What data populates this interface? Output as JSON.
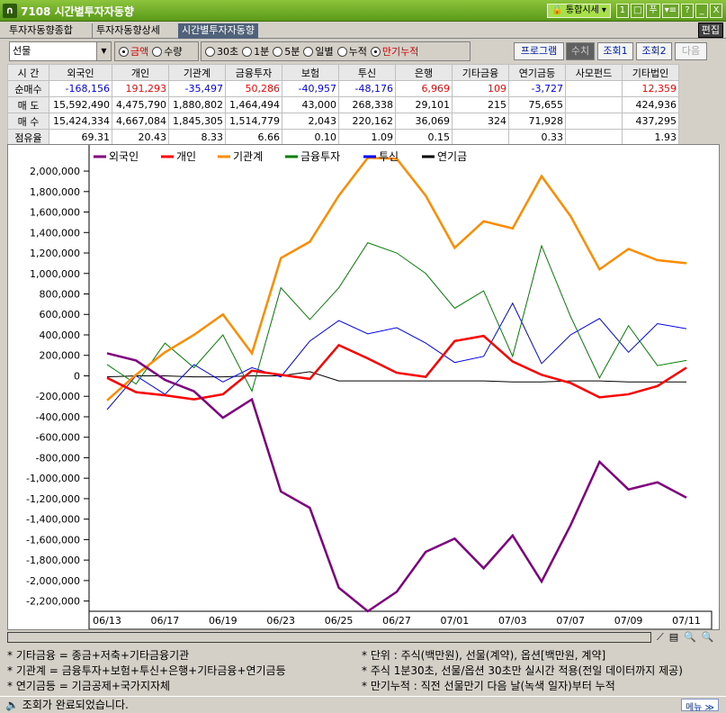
{
  "window": {
    "code": "7108",
    "title": "시간별투자자동향",
    "main_menu": "통합시세",
    "buttons": [
      "1",
      "□",
      "푸",
      "▾≡",
      "?",
      "_",
      "X"
    ]
  },
  "tabs": [
    {
      "label": "투자자동향종합"
    },
    {
      "label": "투자자동향상세"
    },
    {
      "label": "시간별투자자동향"
    }
  ],
  "edit_label": "편집",
  "controls": {
    "market": "선물",
    "unit": [
      {
        "label": "금액",
        "checked": true
      },
      {
        "label": "수량",
        "checked": false
      }
    ],
    "period": [
      {
        "label": "30초",
        "checked": false
      },
      {
        "label": "1분",
        "checked": false
      },
      {
        "label": "5분",
        "checked": false
      },
      {
        "label": "일별",
        "checked": false
      },
      {
        "label": "누적",
        "checked": false
      },
      {
        "label": "만기누적",
        "checked": true
      }
    ],
    "buttons": [
      "프로그램",
      "수치",
      "조회1",
      "조회2",
      "다음"
    ]
  },
  "table": {
    "headers": [
      "시  간",
      "외국인",
      "개인",
      "기관계",
      "금융투자",
      "보험",
      "투신",
      "은행",
      "기타금융",
      "연기금등",
      "사모펀드",
      "기타법인"
    ],
    "rows": [
      {
        "label": "순매수",
        "cells": [
          "-168,156",
          "191,293",
          "-35,497",
          "50,286",
          "-40,957",
          "-48,176",
          "6,969",
          "109",
          "-3,727",
          "",
          "12,359"
        ]
      },
      {
        "label": "매  도",
        "cells": [
          "15,592,490",
          "4,475,790",
          "1,880,802",
          "1,464,494",
          "43,000",
          "268,338",
          "29,101",
          "215",
          "75,655",
          "",
          "424,936"
        ]
      },
      {
        "label": "매  수",
        "cells": [
          "15,424,334",
          "4,667,084",
          "1,845,305",
          "1,514,779",
          "2,043",
          "220,162",
          "36,069",
          "324",
          "71,928",
          "",
          "437,295"
        ]
      },
      {
        "label": "점유율",
        "cells": [
          "69.31",
          "20.43",
          "8.33",
          "6.66",
          "0.10",
          "1.09",
          "0.15",
          "",
          "0.33",
          "",
          "1.93"
        ]
      }
    ]
  },
  "chart_data": {
    "type": "line",
    "ylim": [
      -2300000,
      2150000
    ],
    "yticks": [
      2000000,
      1800000,
      1600000,
      1400000,
      1200000,
      1000000,
      800000,
      600000,
      400000,
      200000,
      0,
      -200000,
      -400000,
      -600000,
      -800000,
      -1000000,
      -1200000,
      -1400000,
      -1600000,
      -1800000,
      -2000000,
      -2200000
    ],
    "ytick_labels": [
      "2,000,000",
      "1,800,000",
      "1,600,000",
      "1,400,000",
      "1,200,000",
      "1,000,000",
      "800,000",
      "600,000",
      "400,000",
      "200,000",
      "0",
      "-200,000",
      "-400,000",
      "-600,000",
      "-800,000",
      "-1,000,000",
      "-1,200,000",
      "-1,400,000",
      "-1,600,000",
      "-1,800,000",
      "-2,000,000",
      "-2,200,000"
    ],
    "x_count": 21,
    "xtick_labels": [
      {
        "i": 0,
        "label": "06/13"
      },
      {
        "i": 2,
        "label": "06/17"
      },
      {
        "i": 4,
        "label": "06/19"
      },
      {
        "i": 6,
        "label": "06/23"
      },
      {
        "i": 8,
        "label": "06/25"
      },
      {
        "i": 10,
        "label": "06/27"
      },
      {
        "i": 12,
        "label": "07/01"
      },
      {
        "i": 14,
        "label": "07/03"
      },
      {
        "i": 16,
        "label": "07/07"
      },
      {
        "i": 18,
        "label": "07/09"
      },
      {
        "i": 20,
        "label": "07/11"
      }
    ],
    "series": [
      {
        "name": "외국인",
        "color": "#800080",
        "width": 2.5,
        "values": [
          220000,
          150000,
          -40000,
          -150000,
          -410000,
          -230000,
          -1130000,
          -1290000,
          -2070000,
          -2300000,
          -2110000,
          -1720000,
          -1590000,
          -1880000,
          -1560000,
          -2010000,
          -1460000,
          -840000,
          -1110000,
          -1040000,
          -1190000
        ]
      },
      {
        "name": "개인",
        "color": "#ff0000",
        "width": 2.5,
        "values": [
          -20000,
          -160000,
          -190000,
          -230000,
          -180000,
          50000,
          10000,
          -30000,
          300000,
          170000,
          30000,
          -10000,
          340000,
          390000,
          140000,
          10000,
          -70000,
          -210000,
          -180000,
          -100000,
          80000
        ]
      },
      {
        "name": "기관계",
        "color": "#ff8c00",
        "width": 2.5,
        "values": [
          -240000,
          10000,
          230000,
          400000,
          600000,
          220000,
          1150000,
          1310000,
          1760000,
          2130000,
          2120000,
          1760000,
          1250000,
          1510000,
          1440000,
          1950000,
          1560000,
          1040000,
          1240000,
          1130000,
          1100000
        ]
      },
      {
        "name": "금융투자",
        "color": "#008000",
        "width": 1,
        "values": [
          110000,
          -80000,
          320000,
          80000,
          400000,
          -150000,
          860000,
          550000,
          860000,
          1300000,
          1200000,
          1000000,
          660000,
          830000,
          190000,
          1270000,
          580000,
          -20000,
          490000,
          100000,
          150000
        ]
      },
      {
        "name": "투신",
        "color": "#0000ff",
        "width": 1,
        "values": [
          -330000,
          0,
          -180000,
          110000,
          -60000,
          80000,
          -10000,
          340000,
          540000,
          410000,
          470000,
          320000,
          130000,
          190000,
          710000,
          120000,
          400000,
          560000,
          230000,
          510000,
          460000
        ]
      },
      {
        "name": "연기금",
        "color": "#000000",
        "width": 1,
        "values": [
          -10000,
          0,
          0,
          -10000,
          -10000,
          0,
          0,
          40000,
          -50000,
          -50000,
          -50000,
          -50000,
          -50000,
          -50000,
          -60000,
          -60000,
          -50000,
          -50000,
          -60000,
          -60000,
          -60000
        ]
      }
    ]
  },
  "notes_left": [
    "* 기타금융 = 종금+저축+기타금융기관",
    "* 기관계 = 금융투자+보험+투신+은행+기타금융+연기금등",
    "* 연기금등 = 기금공제+국가지자체"
  ],
  "notes_right": [
    "* 단위 : 주식(백만원), 선물(계약), 옵션[백만원, 계약]",
    "* 주식 1분30초, 선물/옵션 30초만 실시간 적용(전일 데이터까지 제공)",
    "* 만기누적 : 직전 선물만기 다음 날(녹색 일자)부터 누적"
  ],
  "status": "조회가 완료되었습니다.",
  "menu_label": "메뉴"
}
